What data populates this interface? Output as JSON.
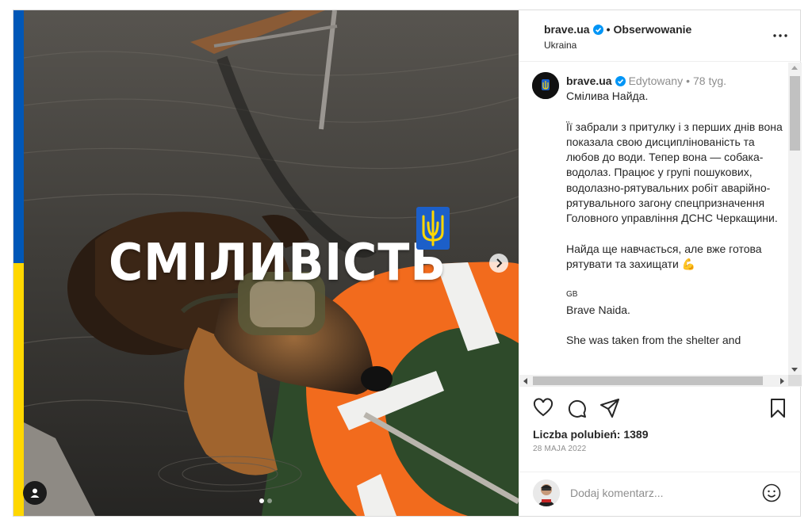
{
  "media": {
    "overlay_title": "СМІЛИВІСТЬ",
    "flag_colors": {
      "blue": "#0057b7",
      "yellow": "#ffd700"
    },
    "trident_color": "#1c5fc9",
    "carousel_index": 1,
    "carousel_total": 2
  },
  "header": {
    "username": "brave.ua",
    "separator": "•",
    "follow_label": "Obserwowanie",
    "location": "Ukraina"
  },
  "caption": {
    "username": "brave.ua",
    "edited": "Edytowany",
    "separator": "•",
    "time": "78 tyg.",
    "lines": [
      "Смілива Найда.",
      "",
      "Її забрали з притулку і з перших днів вона показала свою дисциплінованість та любов до води. Тепер вона — собака-водолаз. Працює у групі пошукових, водолазно-рятувальних робіт аварійно-рятувального загону спецпризначення Головного управління ДСНС Черкащини.",
      "",
      "Найда ще навчається, але вже готова рятувати та захищати 💪",
      "",
      "GB",
      "Brave Naida.",
      "",
      "She was taken from the shelter and"
    ]
  },
  "stats": {
    "likes": "Liczba polubień: 1389",
    "date": "28 MAJA 2022"
  },
  "comment": {
    "placeholder": "Dodaj komentarz..."
  },
  "icons": [
    "more-icon",
    "verified-icon",
    "heart-icon",
    "comment-icon",
    "share-icon",
    "bookmark-icon",
    "emoji-icon",
    "user-tag-icon",
    "next-arrow-icon",
    "trident-icon"
  ],
  "colors": {
    "verified": "#0095f6",
    "accent_orange": "#f26b1d"
  }
}
